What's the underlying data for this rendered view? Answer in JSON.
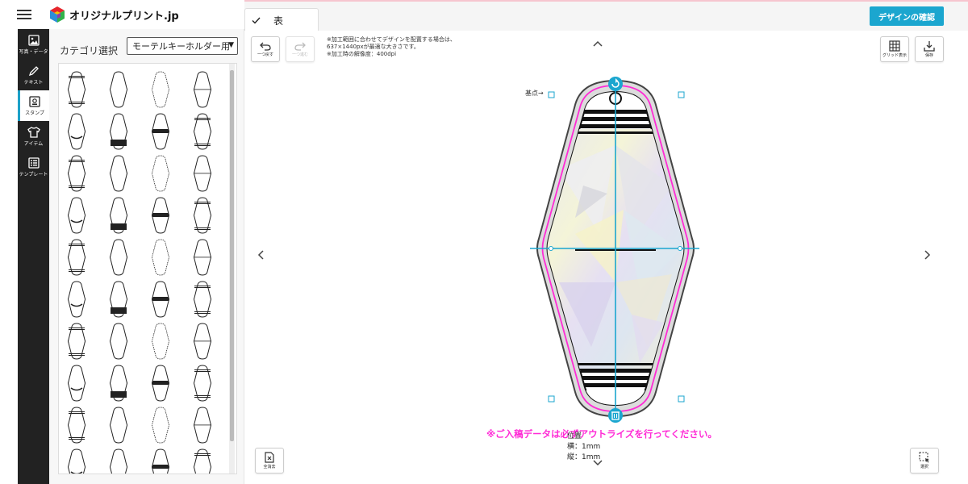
{
  "app": {
    "logo_text": "オリジナルプリント.jp",
    "brand_colors": {
      "accent": "#1ba6cf",
      "warning": "#ff2bd6",
      "sidebar": "#222222"
    }
  },
  "sidebar": {
    "items": [
      {
        "label": "写真・データ",
        "icon": "image-icon"
      },
      {
        "label": "テキスト",
        "icon": "pencil-icon"
      },
      {
        "label": "スタンプ",
        "icon": "stamp-icon",
        "active": true
      },
      {
        "label": "アイテム",
        "icon": "tshirt-icon"
      },
      {
        "label": "テンプレート",
        "icon": "list-icon"
      }
    ]
  },
  "stamp_panel": {
    "category_label": "カテゴリ選択",
    "category_selected": "モーテルキーホルダー用"
  },
  "top": {
    "side_tab_label": "表",
    "confirm_button": "デザインの確認"
  },
  "toolbar": {
    "undo": "一つ戻す",
    "redo": "一つ進む",
    "grid": "グリッド表示",
    "save": "保存",
    "delete_all": "全消去",
    "select": "選択"
  },
  "notice": {
    "line1": "※加工範囲に合わせてデザインを配置する場合は、",
    "line2": "637×1440pxが最適な大きさです。",
    "line3": "※加工時の解像度：400dpi"
  },
  "canvas": {
    "base_point_label": "基点→",
    "warning": "※ご入稿データは必ずアウトライズを行ってください。",
    "position_title": "位置",
    "pos_x": "横：1mm",
    "pos_y": "縦：1mm"
  }
}
